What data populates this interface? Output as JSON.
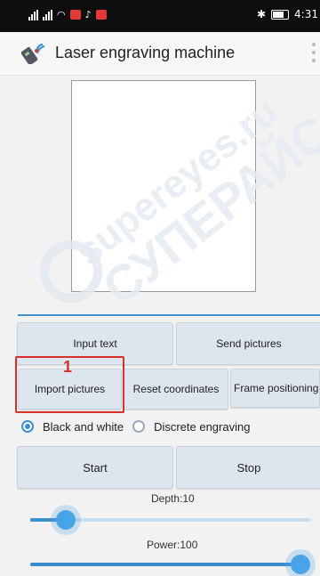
{
  "status_bar": {
    "time": "4:31"
  },
  "app": {
    "title": "Laser engraving machine"
  },
  "buttons": {
    "input_text": "Input text",
    "send_pictures": "Send pictures",
    "import_pictures": "Import pictures",
    "reset_coordinates": "Reset coordinates",
    "frame_positioning": "Frame positioning",
    "start": "Start",
    "stop": "Stop"
  },
  "annotation": {
    "number": "1"
  },
  "modes": [
    {
      "label": "Black and white",
      "selected": true
    },
    {
      "label": "Discrete engraving",
      "selected": false
    }
  ],
  "depth": {
    "label": "Depth:10",
    "value": 10,
    "level": 0.1
  },
  "power": {
    "label": "Power:100",
    "value": 100,
    "level": 1.0
  },
  "watermark": {
    "text1": "supereyes.ru",
    "text2": "СУПЕРАЙС"
  },
  "colors": {
    "accent": "#3b8fd0",
    "highlight": "#d9302a"
  }
}
